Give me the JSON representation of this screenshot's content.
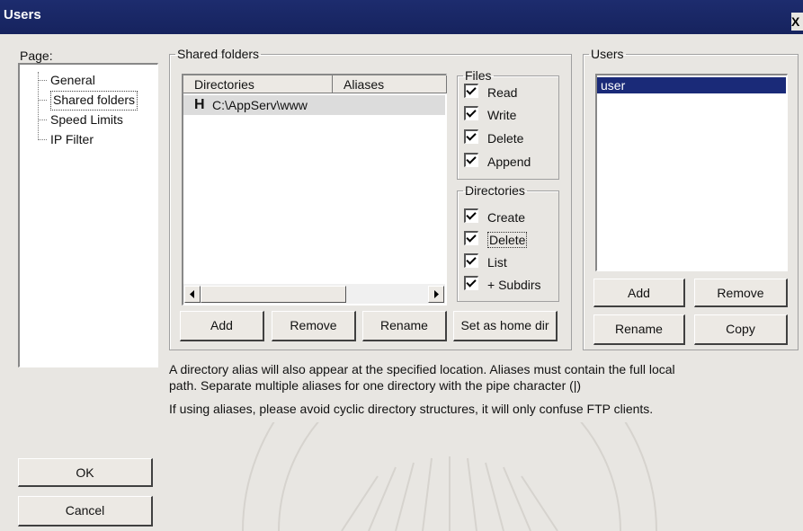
{
  "window": {
    "title": "Users",
    "close_glyph": "X"
  },
  "page_label": "Page:",
  "tree": [
    "General",
    "Shared folders",
    "Speed Limits",
    "IP Filter"
  ],
  "shared_folders": {
    "legend": "Shared folders",
    "columns": [
      "Directories",
      "Aliases"
    ],
    "rows": [
      {
        "marker": "H",
        "directory": "C:\\AppServ\\www",
        "aliases": ""
      }
    ],
    "buttons": {
      "add": "Add",
      "remove": "Remove",
      "rename": "Rename",
      "home": "Set as home dir"
    }
  },
  "files": {
    "legend": "Files",
    "items": [
      {
        "label": "Read",
        "checked": true
      },
      {
        "label": "Write",
        "checked": true
      },
      {
        "label": "Delete",
        "checked": true
      },
      {
        "label": "Append",
        "checked": true
      }
    ]
  },
  "directories": {
    "legend": "Directories",
    "items": [
      {
        "label": "Create",
        "checked": true
      },
      {
        "label": "Delete",
        "checked": true
      },
      {
        "label": "List",
        "checked": true
      },
      {
        "label": "+ Subdirs",
        "checked": true
      }
    ]
  },
  "users": {
    "legend": "Users",
    "list": [
      "user"
    ],
    "selected": "user",
    "buttons": {
      "add": "Add",
      "remove": "Remove",
      "rename": "Rename",
      "copy": "Copy"
    }
  },
  "info": {
    "line1": "A directory alias will also appear at the specified location. Aliases must contain the full local",
    "line2": "path. Separate multiple aliases for one directory with the pipe character (|)",
    "line3": "If using aliases, please avoid cyclic directory structures, it will only confuse FTP clients."
  },
  "footer": {
    "ok": "OK",
    "cancel": "Cancel"
  },
  "colors": {
    "titlebar": "#1d2c6e",
    "selection": "#1a2a78",
    "face": "#e8e6e2"
  }
}
